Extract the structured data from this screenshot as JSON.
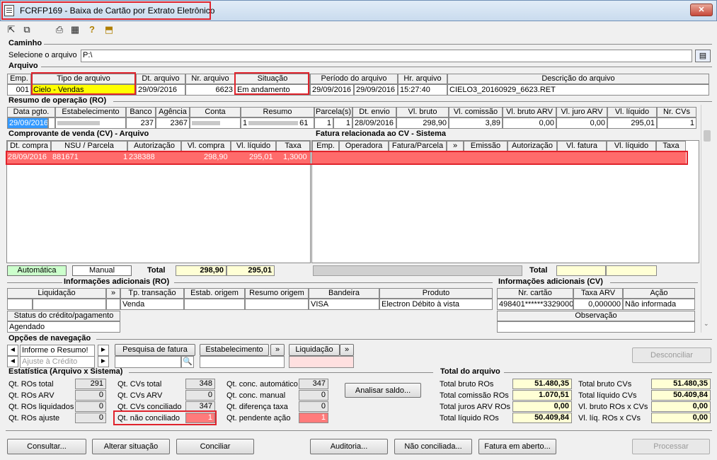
{
  "window": {
    "title": "FCRFP169 - Baixa de Cartão por Extrato Eletrônico",
    "close": "✕"
  },
  "toolbar": {
    "icons": [
      "export-icon",
      "copy-icon",
      "print-icon",
      "calculator-icon",
      "help-icon",
      "exit-icon"
    ]
  },
  "caminho": {
    "section": "Caminho",
    "label": "Selecione o arquivo",
    "value": "P:\\"
  },
  "arquivo": {
    "section": "Arquivo",
    "headers": [
      "Emp.",
      "Tipo de arquivo",
      "Dt. arquivo",
      "Nr. arquivo",
      "Situação",
      "Período do arquivo",
      "Hr. arquivo",
      "Descrição do arquivo"
    ],
    "row": {
      "emp": "001",
      "tipo": "Cielo - Vendas",
      "dt": "29/09/2016",
      "nr": "6623",
      "situacao": "Em andamento",
      "periodo_ini": "29/09/2016",
      "periodo_fim": "29/09/2016",
      "hr": "15:27:40",
      "descricao": "CIELO3_20160929_6623.RET"
    }
  },
  "ro": {
    "section": "Resumo de operação (RO)",
    "headers": [
      "Data pgto.",
      "Estabelecimento",
      "Banco",
      "Agência",
      "Conta",
      "Resumo",
      "Parcela(s)",
      "Dt. envio",
      "Vl. bruto",
      "Vl. comissão",
      "Vl. bruto ARV",
      "Vl. juro ARV",
      "Vl. líquido",
      "Nr. CVs"
    ],
    "row": {
      "data": "29/09/2016",
      "estab": "",
      "banco": "237",
      "agencia": "2367",
      "conta": "",
      "resumo": "1",
      "resumo_end": "61",
      "parc1": "1",
      "parc2": "1",
      "envio": "28/09/2016",
      "bruto": "298,90",
      "comissao": "3,89",
      "bruto_arv": "0,00",
      "juro_arv": "0,00",
      "liquido": "295,01",
      "nr_cvs": "1"
    }
  },
  "cv": {
    "section": "Comprovante de venda (CV) - Arquivo",
    "headers": [
      "Dt. compra",
      "NSU / Parcela",
      "Autorização",
      "Vl. compra",
      "Vl. líquido",
      "Taxa"
    ],
    "row": {
      "dt": "28/09/2016",
      "nsu": "881671",
      "parcela": "1",
      "aut": "238388",
      "compra": "298,90",
      "liquido": "295,01",
      "taxa": "1,3000"
    },
    "legend_auto": "Automática",
    "legend_manual": "Manual",
    "total_label": "Total",
    "total_compra": "298,90",
    "total_liquido": "295,01"
  },
  "fatura": {
    "section": "Fatura relacionada ao CV - Sistema",
    "headers": [
      "Emp.",
      "Operadora",
      "Fatura/Parcela",
      "»",
      "Emissão",
      "Autorização",
      "Vl. fatura",
      "Vl. líquido",
      "Taxa"
    ],
    "total_label": "Total"
  },
  "info_ro": {
    "section": "Informações adicionais (RO)",
    "headers": [
      "Liquidação",
      "»",
      "Tp. transação",
      "Estab. origem",
      "Resumo origem",
      "Bandeira",
      "Produto"
    ],
    "row": {
      "tp": "Venda",
      "bandeira": "VISA",
      "produto": "Electron Débito à vista"
    },
    "status_label": "Status do crédito/pagamento",
    "status_value": "Agendado"
  },
  "info_cv": {
    "section": "Informações adicionais (CV)",
    "headers": [
      "Nr. cartão",
      "Taxa ARV",
      "Ação"
    ],
    "row": {
      "cartao": "498401******3329000",
      "taxa": "0,000000",
      "acao": "Não informada"
    },
    "obs_label": "Observação"
  },
  "nav": {
    "section": "Opções de navegação",
    "resumo_placeholder": "Informe o Resumo!",
    "ajuste": "Ajuste à Crédito",
    "pesquisa": "Pesquisa de fatura",
    "estab": "Estabelecimento",
    "liquidacao": "Liquidação",
    "desconciliar": "Desconciliar"
  },
  "stats": {
    "section": "Estatística (Arquivo x Sistema)",
    "col1": [
      {
        "label": "Qt. ROs total",
        "value": "291"
      },
      {
        "label": "Qt. ROs ARV",
        "value": "0"
      },
      {
        "label": "Qt. ROs liquidados",
        "value": "0"
      },
      {
        "label": "Qt. ROs ajuste",
        "value": "0"
      }
    ],
    "col2": [
      {
        "label": "Qt. CVs total",
        "value": "348"
      },
      {
        "label": "Qt. CVs ARV",
        "value": "0"
      },
      {
        "label": "Qt. CVs conciliado",
        "value": "347"
      },
      {
        "label": "Qt. não conciliado",
        "value": "1"
      }
    ],
    "col3": [
      {
        "label": "Qt. conc. automático",
        "value": "347"
      },
      {
        "label": "Qt. conc. manual",
        "value": "0"
      },
      {
        "label": "Qt. diferença taxa",
        "value": "0"
      },
      {
        "label": "Qt. pendente ação",
        "value": "1"
      }
    ],
    "analisar": "Analisar saldo..."
  },
  "total_arquivo": {
    "section": "Total do arquivo",
    "left": [
      {
        "label": "Total bruto ROs",
        "value": "51.480,35"
      },
      {
        "label": "Total comissão ROs",
        "value": "1.070,51"
      },
      {
        "label": "Total juros ARV ROs",
        "value": "0,00"
      },
      {
        "label": "Total líquido ROs",
        "value": "50.409,84"
      }
    ],
    "right": [
      {
        "label": "Total bruto CVs",
        "value": "51.480,35"
      },
      {
        "label": "Total líquido CVs",
        "value": "50.409,84"
      },
      {
        "label": "Vl. bruto ROs x CVs",
        "value": "0,00"
      },
      {
        "label": "Vl. líq. ROs x CVs",
        "value": "0,00"
      }
    ]
  },
  "footer": {
    "consultar": "Consultar...",
    "alterar": "Alterar situação",
    "conciliar": "Conciliar",
    "auditoria": "Auditoria...",
    "nao_conciliada": "Não conciliada...",
    "fatura_aberto": "Fatura em aberto...",
    "processar": "Processar"
  },
  "colors": {
    "highlight_red": "#ff6b6b",
    "yellow": "#ffff00",
    "selected_blue": "#3399ff",
    "legend_green": "#ccffcc"
  }
}
